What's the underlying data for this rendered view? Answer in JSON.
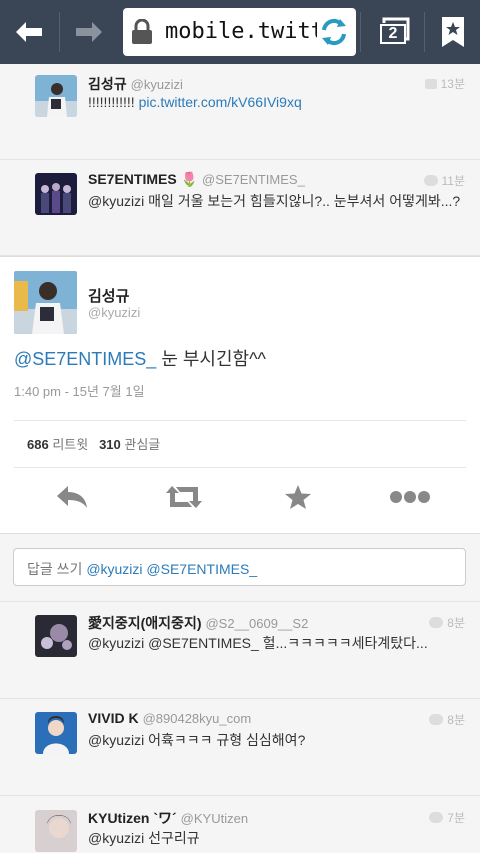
{
  "browser": {
    "url": "mobile.twitter",
    "tab_count": "2"
  },
  "replies_above": [
    {
      "name": "김성규",
      "handle": "@kyuzizi",
      "text_prefix": "!!!!!!!!!!!!",
      "text_link": "pic.twitter.com/kV66IVi9xq",
      "time": "13분"
    },
    {
      "name": "SE7ENTIMES",
      "name_emoji": "🌷",
      "handle": "@SE7ENTIMES_",
      "text": "@kyuzizi 매일 거울 보는거 힘들지않니?.. 눈부셔서 어떻게봐...?",
      "time": "11분"
    }
  ],
  "main_tweet": {
    "name": "김성규",
    "handle": "@kyuzizi",
    "mention": "@SE7ENTIMES_",
    "text": " 눈 부시긴함^^",
    "timestamp": "1:40 pm - 15년 7월 1일",
    "retweet_count": "686",
    "retweet_label": "리트윗",
    "fav_count": "310",
    "fav_label": "관심글"
  },
  "reply_box": {
    "label": "답글 쓰기",
    "mentions": "@kyuzizi @SE7ENTIMES_"
  },
  "replies_below": [
    {
      "name": "愛지중지(애지중지)",
      "handle": "@S2__0609__S2",
      "text": "@kyuzizi @SE7ENTIMES_ 헐...ㅋㅋㅋㅋㅋ세타계탔다...",
      "time": "8분"
    },
    {
      "name": "VIVID K",
      "handle": "@890428kyu_com",
      "text": "@kyuzizi 어휵ㅋㅋㅋ 규형 심심해여?",
      "time": "8분"
    },
    {
      "name": "KYUtizen `ワ´",
      "handle": "@KYUtizen",
      "text": "@kyuzizi 선구리규",
      "time": "7분"
    }
  ],
  "colors": {
    "toolbar": "#3a4655",
    "link": "#2b7bb9",
    "background": "#f5f5f5"
  }
}
